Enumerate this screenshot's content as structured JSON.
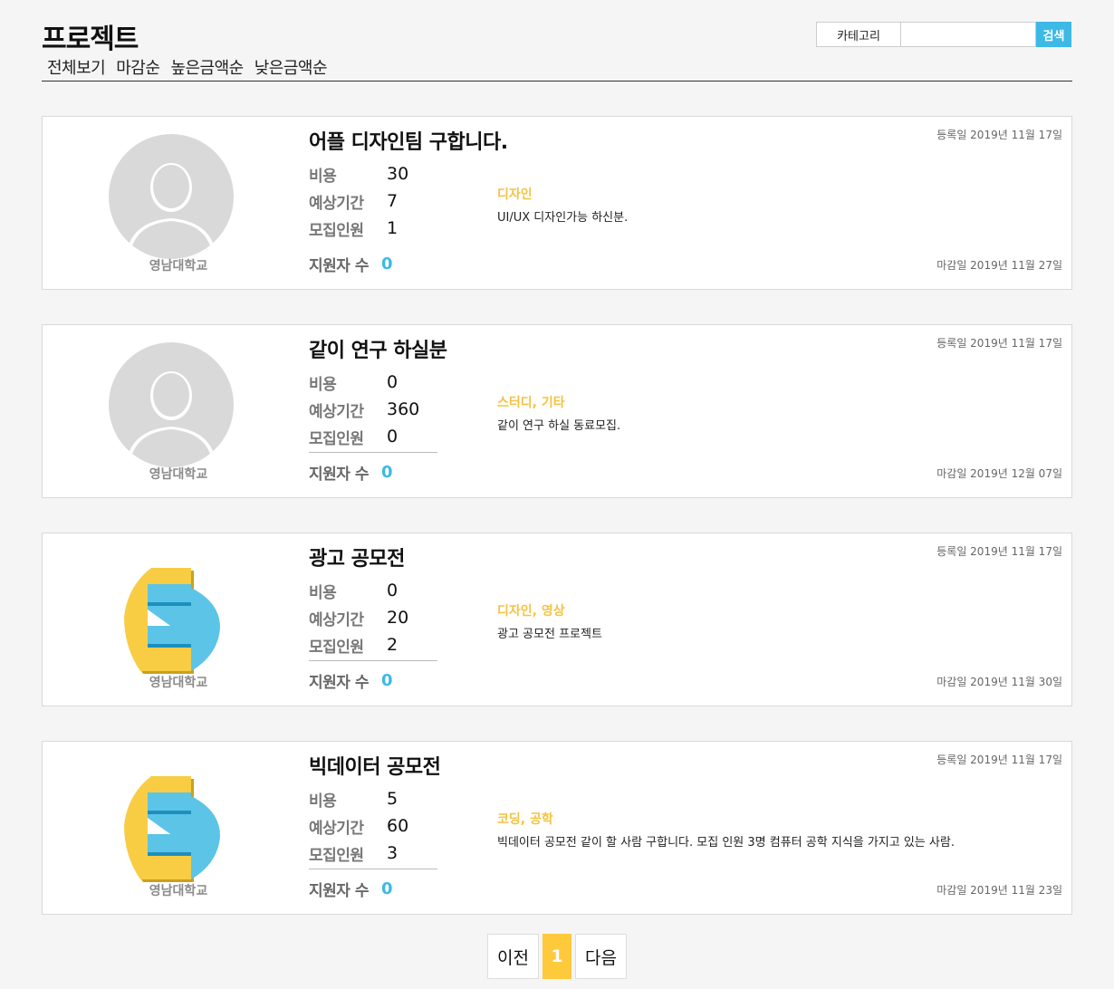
{
  "header": {
    "title": "프로젝트",
    "sort_tabs": [
      "전체보기",
      "마감순",
      "높은금액순",
      "낮은금액순"
    ],
    "category_label": "카테고리",
    "search_placeholder": "",
    "search_label": "검색"
  },
  "labels": {
    "cost": "비용",
    "duration": "예상기간",
    "recruits": "모집인원",
    "applicants": "지원자 수"
  },
  "colors": {
    "accent_blue": "#3cb9e6",
    "accent_yellow": "#f5c242",
    "page_current": "#ffc93c"
  },
  "projects": [
    {
      "title": "어플 디자인팀 구합니다.",
      "avatar": "default-user-avatar",
      "school": "영남대학교",
      "cost": "30",
      "duration": "7",
      "recruits": "1",
      "applicants": "0",
      "category": "디자인",
      "description": "UI/UX 디자인가능 하신분.",
      "reg_date": "등록일 2019년 11월 17일",
      "due_date": "마감일 2019년 11월 27일"
    },
    {
      "title": "같이 연구 하실분",
      "avatar": "default-user-avatar",
      "school": "영남대학교",
      "cost": "0",
      "duration": "360",
      "recruits": "0",
      "applicants": "0",
      "category": "스터디, 기타",
      "description": "같이 연구 하실 동료모집.",
      "reg_date": "등록일 2019년 11월 17일",
      "due_date": "마감일 2019년 12월 07일"
    },
    {
      "title": "광고 공모전",
      "avatar": "university-logo",
      "school": "영남대학교",
      "cost": "0",
      "duration": "20",
      "recruits": "2",
      "applicants": "0",
      "category": "디자인, 영상",
      "description": "광고 공모전 프로젝트",
      "reg_date": "등록일 2019년 11월 17일",
      "due_date": "마감일 2019년 11월 30일"
    },
    {
      "title": "빅데이터 공모전",
      "avatar": "university-logo",
      "school": "영남대학교",
      "cost": "5",
      "duration": "60",
      "recruits": "3",
      "applicants": "0",
      "category": "코딩, 공학",
      "description": "빅데이터 공모전 같이 할 사람 구합니다. 모집 인원 3명 컴퓨터 공학 지식을 가지고 있는 사람.",
      "reg_date": "등록일 2019년 11월 17일",
      "due_date": "마감일 2019년 11월 23일"
    }
  ],
  "pagination": {
    "prev": "이전",
    "current": "1",
    "next": "다음"
  }
}
